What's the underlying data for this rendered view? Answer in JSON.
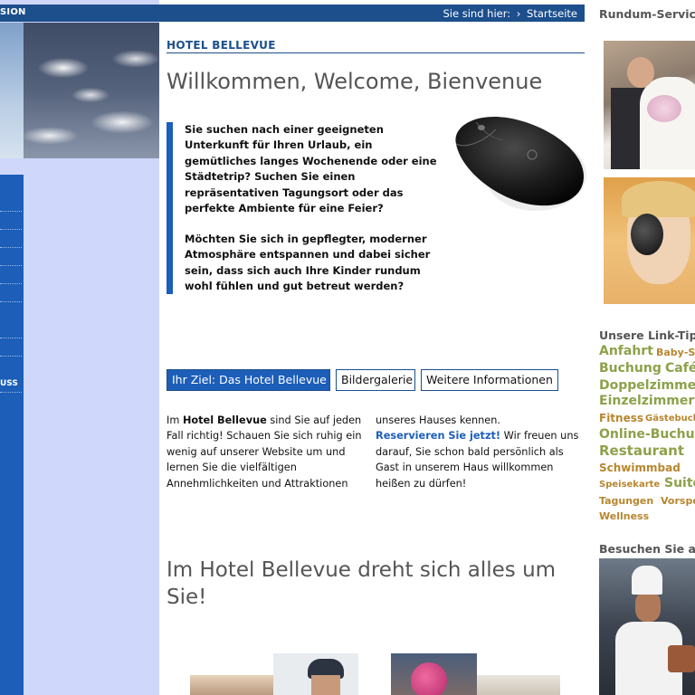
{
  "header": {
    "left_label": "SION",
    "breadcrumb_label": "Sie sind hier:",
    "breadcrumb_sep": "›",
    "breadcrumb_current": "Startseite"
  },
  "sidebar": {
    "nav_label": "USS"
  },
  "main": {
    "hotel_title": "HOTEL BELLEVUE",
    "welcome": "Willkommen, Welcome, Bienvenue",
    "intro_p1": "Sie suchen nach einer geeigneten Unterkunft für Ihren Urlaub, ein gemütliches langes Wochenende oder eine Städtetrip? Suchen Sie einen repräsentativen Tagungsort oder das perfekte Ambiente für eine Feier?",
    "intro_p2": "Möchten Sie sich in gepflegter, moderner Atmosphäre entspannen und dabei sicher sein, dass sich auch Ihre Kinder rundum wohl fühlen und gut betreut werden?",
    "tabs": [
      {
        "label": "Ihr Ziel: Das Hotel Bellevue"
      },
      {
        "label": "Bildergalerie"
      },
      {
        "label": "Weitere Informationen"
      }
    ],
    "col_a_pre": "Im ",
    "col_a_bold": "Hotel Bellevue",
    "col_a_post": " sind Sie auf jeden Fall richtig! Schauen Sie sich ruhig ein wenig auf unserer Website um und lernen Sie die vielfältigen Annehmlichkeiten und Attraktionen",
    "col_b_pre": "unseres Hauses kennen.",
    "col_b_link": "Reservieren Sie jetzt!",
    "col_b_post": " Wir freuen uns darauf, Sie schon bald persönlich als Gast in unserem Haus willkommen heißen zu dürfen!",
    "headline2": "Im Hotel Bellevue dreht sich alles um Sie!"
  },
  "right": {
    "service_title": "Rundum-Service für Sie!",
    "linktips_title": "Unsere Link-Tipps",
    "tags": [
      {
        "text": "Anfahrt",
        "size": 14
      },
      {
        "text": "Baby-Service",
        "size": 11
      },
      {
        "text": "Buchung",
        "size": 14
      },
      {
        "text": "Café",
        "size": 14
      },
      {
        "text": "Doppelzimmer",
        "size": 14
      },
      {
        "text": "Einzelzimmer",
        "size": 14
      },
      {
        "text": "Fitness",
        "size": 12
      },
      {
        "text": "Gästebuch",
        "size": 10
      },
      {
        "text": "Online-Buchung",
        "size": 14
      },
      {
        "text": "Restaurant",
        "size": 15
      },
      {
        "text": "Schwimmbad",
        "size": 12
      },
      {
        "text": "Speisekarte",
        "size": 10
      },
      {
        "text": "Suite",
        "size": 14
      },
      {
        "text": "Tagungen",
        "size": 11
      },
      {
        "text": "Vorspeisen",
        "size": 11
      },
      {
        "text": "Wellness",
        "size": 11
      }
    ],
    "visit_title": "Besuchen Sie auch"
  },
  "colors": {
    "brand_blue": "#1c4f8c",
    "accent_blue": "#1c5eb8",
    "sidebar_bg": "#cfd8fb",
    "tag_olive": "#a0903c"
  }
}
